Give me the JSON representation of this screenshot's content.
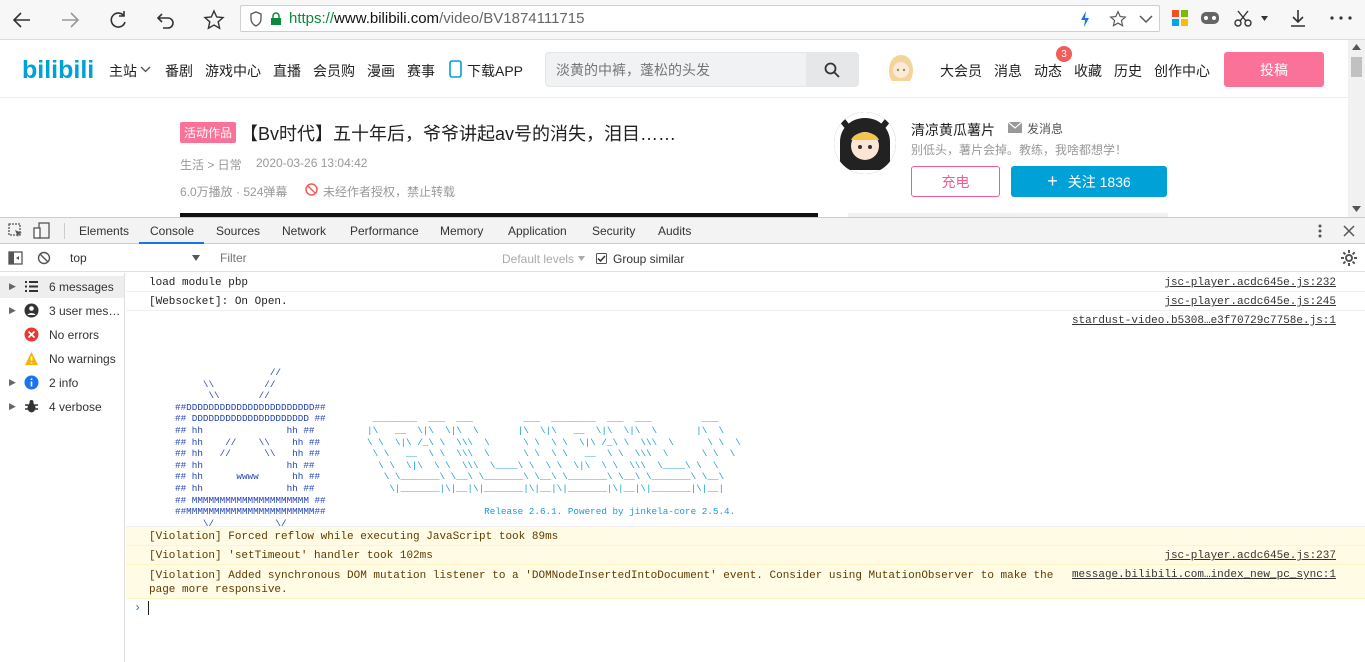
{
  "browser": {
    "url_scheme": "https://",
    "url_domain": "www.bilibili.com",
    "url_path": "/video/BV1874111715"
  },
  "nav": {
    "logo": "bilibili",
    "items": [
      "主站",
      "番剧",
      "游戏中心",
      "直播",
      "会员购",
      "漫画",
      "赛事",
      "下载APP"
    ],
    "search_placeholder": "淡黄的中裤，蓬松的头发",
    "right_items": [
      "大会员",
      "消息",
      "动态",
      "收藏",
      "历史",
      "创作中心"
    ],
    "badge": "3",
    "upload": "投稿"
  },
  "video": {
    "tag": "活动作品",
    "title": "【Bv时代】五十年后，爷爷讲起av号的消失，泪目……",
    "category": "生活 > 日常",
    "date": "2020-03-26 13:04:42",
    "stats": "6.0万播放 · 524弹幕",
    "copyright": "未经作者授权，禁止转载"
  },
  "uploader": {
    "name": "清凉黄瓜薯片",
    "message": "发消息",
    "sign": "别低头，薯片会掉。教练，我啥都想学！",
    "charge": "充电",
    "follow": "关注 1836"
  },
  "devtools": {
    "tabs": [
      "Elements",
      "Console",
      "Sources",
      "Network",
      "Performance",
      "Memory",
      "Application",
      "Security",
      "Audits"
    ],
    "active_tab": "Console",
    "context": "top",
    "filter_placeholder": "Filter",
    "levels": "Default levels",
    "group_similar": "Group similar",
    "sidebar": [
      {
        "label": "6 messages",
        "icon": "list-icon"
      },
      {
        "label": "3 user mess...",
        "icon": "user-icon"
      },
      {
        "label": "No errors",
        "icon": "error-icon"
      },
      {
        "label": "No warnings",
        "icon": "warning-icon"
      },
      {
        "label": "2 info",
        "icon": "info-icon"
      },
      {
        "label": "4 verbose",
        "icon": "bug-icon"
      }
    ],
    "logs": [
      {
        "text": "load module pbp",
        "source": "jsc-player.acdc645e.js:232"
      },
      {
        "text": "[Websocket]: On Open.",
        "source": "jsc-player.acdc645e.js:245"
      },
      {
        "text": "",
        "source": "stardust-video.b5308…e3f70729c7758e.js:1"
      },
      {
        "text": "[Violation] Forced reflow while executing JavaScript took 89ms",
        "source": ""
      },
      {
        "text": "[Violation] 'setTimeout' handler took 102ms",
        "source": "jsc-player.acdc645e.js:237"
      },
      {
        "text": "[Violation] Added synchronous DOM mutation listener to a 'DOMNodeInsertedIntoDocument' event. Consider using MutationObserver to make the\npage more responsive.",
        "source": "message.bilibili.com…index_new_pc_sync:1"
      }
    ],
    "ascii_left": "                 //\n     \\\\         //\n      \\\\       //\n##DDDDDDDDDDDDDDDDDDDDDDD##\n## DDDDDDDDDDDDDDDDDDDDD ##\n## hh               hh ##\n## hh    //    \\\\    hh ##\n## hh   //      \\\\   hh ##\n## hh               hh ##\n## hh      wwww      hh ##\n## hh               hh ##\n## MMMMMMMMMMMMMMMMMMMMM ##\n##MMMMMMMMMMMMMMMMMMMMMMM##\n     \\/           \\/",
    "ascii_right": "\n\n\n\n ________  ___  ___         ___  ________  ___  ___         ___\n|\\   __  \\|\\  \\|\\  \\       |\\  \\|\\   __  \\|\\  \\|\\  \\       |\\  \\\n\\ \\  \\|\\ /_\\ \\  \\\\\\  \\      \\ \\  \\ \\  \\|\\ /_\\ \\  \\\\\\  \\      \\ \\  \\\n \\ \\   __  \\ \\  \\\\\\  \\      \\ \\  \\ \\   __  \\ \\  \\\\\\  \\      \\ \\  \\\n  \\ \\  \\|\\  \\ \\  \\\\\\  \\____\\ \\  \\ \\  \\|\\  \\ \\  \\\\\\  \\____\\ \\  \\\n   \\ \\_______\\ \\__\\ \\_______\\ \\__\\ \\_______\\ \\__\\ \\_______\\ \\__\\\n    \\|_______|\\|__|\\|_______|\\|__|\\|_______|\\|__|\\|_______|\\|__|\n\n                     Release 2.6.1. Powered by jinkela-core 2.5.4."
  }
}
